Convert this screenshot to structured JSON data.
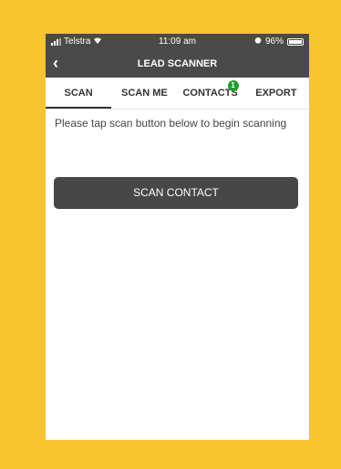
{
  "status_bar": {
    "carrier": "Telstra",
    "time": "11:09 am",
    "battery": "96%"
  },
  "nav": {
    "back_icon": "‹",
    "title": "LEAD SCANNER"
  },
  "tabs": [
    {
      "label": "SCAN",
      "active": true
    },
    {
      "label": "SCAN ME",
      "active": false
    },
    {
      "label": "CONTACTS",
      "active": false,
      "badge": "1"
    },
    {
      "label": "EXPORT",
      "active": false
    }
  ],
  "content": {
    "instructions": "Please tap scan button below to begin scanning",
    "scan_button": "SCAN CONTACT"
  },
  "colors": {
    "background": "#F9C52F",
    "bar": "#4a4a4a",
    "button": "#474747",
    "badge": "#1f9d2e"
  }
}
